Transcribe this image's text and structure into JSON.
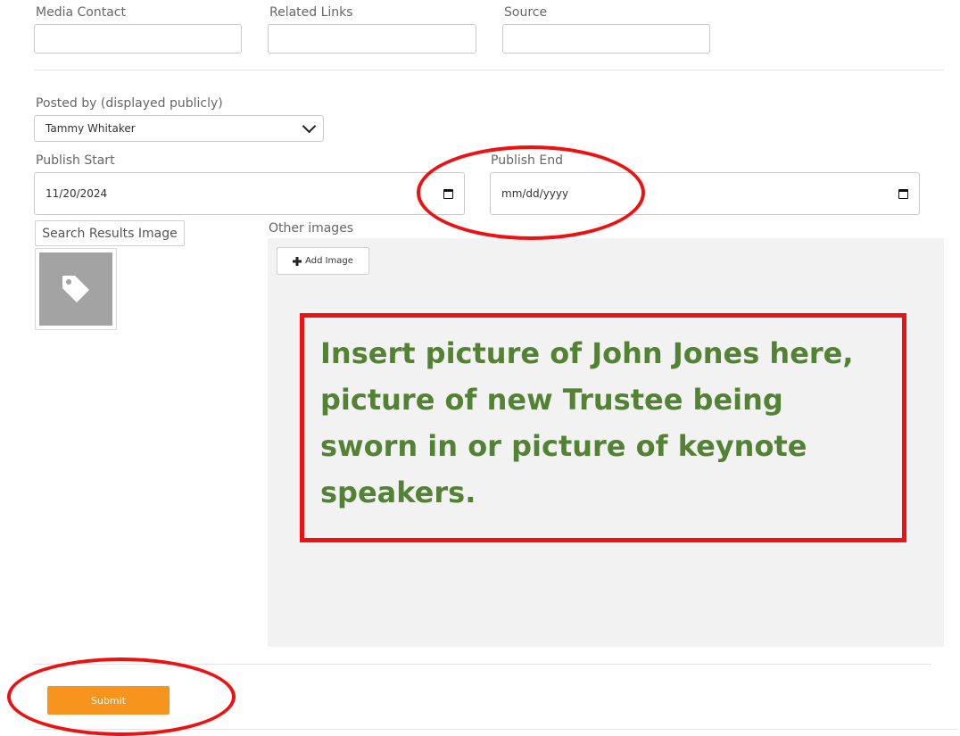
{
  "labels": {
    "media_contact": "Media Contact",
    "related_links": "Related Links",
    "source": "Source",
    "posted_by": "Posted by (displayed publicly)",
    "publish_start": "Publish Start",
    "publish_end": "Publish End",
    "other_images": "Other images"
  },
  "fields": {
    "media_contact_value": "",
    "related_links_value": "",
    "source_value": "",
    "posted_by_selected": "Tammy Whitaker",
    "publish_start_value": "11/20/2024",
    "publish_end_placeholder": "mm/dd/yyyy"
  },
  "buttons": {
    "search_results_image": "Search Results Image",
    "add_image": "Add Image",
    "submit": "Submit"
  },
  "annotation": {
    "note_text": "Insert picture of John Jones here, picture of new Trustee being sworn in or picture of keynote speakers.",
    "note_text_color": "#548235",
    "highlight_color": "#ee1111"
  },
  "colors": {
    "submit": "#f7941d"
  },
  "icons": {
    "select": "chevron-down-icon",
    "date": "calendar-icon",
    "thumbnail": "tag-icon",
    "add": "plus-icon"
  }
}
